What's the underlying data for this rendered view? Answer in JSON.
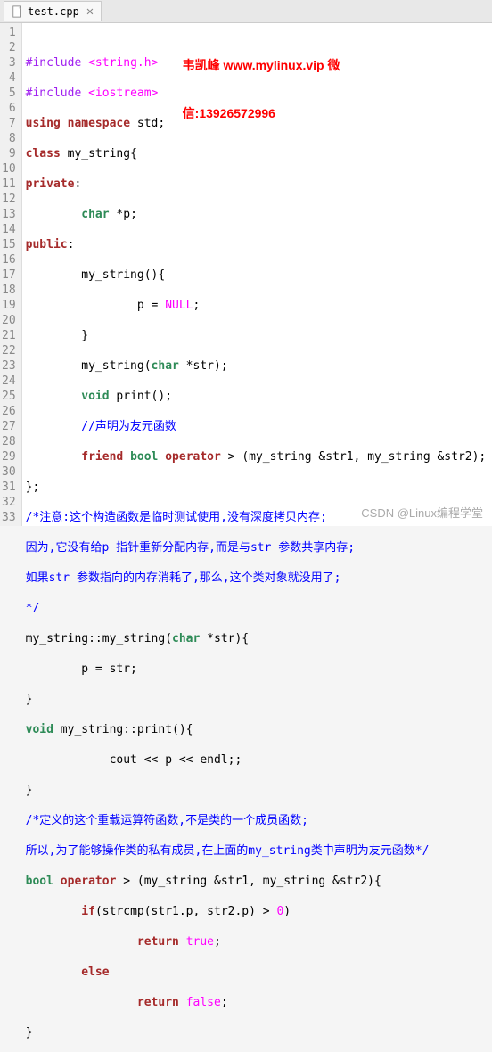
{
  "tab": {
    "filename": "test.cpp",
    "close": "✕"
  },
  "overlay": {
    "line1": "韦凯峰 www.mylinux.vip 微",
    "line2": "信:13926572996"
  },
  "watermark": "CSDN @Linux编程学堂",
  "lines": {
    "l1": {
      "a": "#include",
      "b": " <string.h>"
    },
    "l2": {
      "a": "#include",
      "b": " <iostream>"
    },
    "l3": {
      "a": "using namespace",
      "b": " std;"
    },
    "l4": {
      "a": "class",
      "b": " my_string{"
    },
    "l5": {
      "a": "private",
      "b": ":"
    },
    "l6": {
      "a": "        ",
      "b": "char",
      "c": " *p;"
    },
    "l7": {
      "a": "public",
      "b": ":"
    },
    "l8": {
      "a": "        my_string(){"
    },
    "l9": {
      "a": "                p = ",
      "b": "NULL",
      "c": ";"
    },
    "l10": {
      "a": "        }"
    },
    "l11": {
      "a": "        my_string(",
      "b": "char",
      "c": " *str);"
    },
    "l12": {
      "a": "        ",
      "b": "void",
      "c": " print();"
    },
    "l13": {
      "a": "        ",
      "b": "//声明为友元函数"
    },
    "l14": {
      "a": "        ",
      "b": "friend",
      "c": " ",
      "d": "bool",
      "e": " ",
      "f": "operator",
      "g": " > (my_string &str1, my_string &str2);"
    },
    "l15": {
      "a": "};"
    },
    "l16": {
      "a": "/*注意:这个构造函数是临时测试使用,没有深度拷贝内存;"
    },
    "l17": {
      "a": "因为,它没有给p 指针重新分配内存,而是与str 参数共享内存;"
    },
    "l18": {
      "a": "如果str 参数指向的内存消耗了,那么,这个类对象就没用了;"
    },
    "l19": {
      "a": "*/"
    },
    "l20": {
      "a": "my_string::my_string(",
      "b": "char",
      "c": " *str){"
    },
    "l21": {
      "a": "        p = str;"
    },
    "l22": {
      "a": "}"
    },
    "l23": {
      "a": "void",
      "b": " my_string::print(){"
    },
    "l24": {
      "a": "            cout << p << endl;;"
    },
    "l25": {
      "a": "}"
    },
    "l26": {
      "a": "/*定义的这个重载运算符函数,不是类的一个成员函数;"
    },
    "l27": {
      "a": "所以,为了能够操作类的私有成员,在上面的my_string类中声明为友元函数*/"
    },
    "l28": {
      "a": "bool",
      "b": " ",
      "c": "operator",
      "d": " > (my_string &str1, my_string &str2){"
    },
    "l29": {
      "a": "        ",
      "b": "if",
      "c": "(strcmp(str1.p, str2.p) > ",
      "d": "0",
      "e": ")"
    },
    "l30": {
      "a": "                ",
      "b": "return",
      "c": " ",
      "d": "true",
      "e": ";"
    },
    "l31": {
      "a": "        ",
      "b": "else"
    },
    "l32": {
      "a": "                ",
      "b": "return",
      "c": " ",
      "d": "false",
      "e": ";"
    },
    "l33": {
      "a": "}"
    }
  },
  "linenums": [
    "1",
    "2",
    "3",
    "4",
    "5",
    "6",
    "7",
    "8",
    "9",
    "10",
    "11",
    "12",
    "13",
    "14",
    "15",
    "16",
    "17",
    "18",
    "19",
    "20",
    "21",
    "22",
    "23",
    "24",
    "25",
    "26",
    "27",
    "28",
    "29",
    "30",
    "31",
    "32",
    "33"
  ]
}
